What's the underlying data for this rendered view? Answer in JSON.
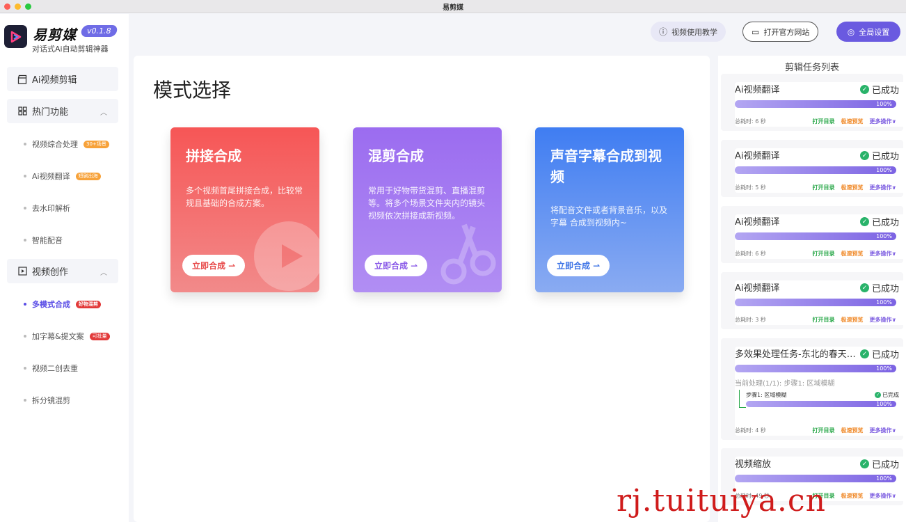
{
  "window": {
    "title": "易剪媒"
  },
  "brand": {
    "name": "易剪媒",
    "version": "v0.1.8",
    "slogan": "对话式Ai自动剪辑神器"
  },
  "nav": {
    "item1": "Ai视频剪辑",
    "group1": {
      "label": "热门功能",
      "items": [
        {
          "label": "视频综合处理",
          "tag": "30+场景"
        },
        {
          "label": "Ai视频翻译",
          "tag": "短剧出海"
        },
        {
          "label": "去水印解析"
        },
        {
          "label": "智能配音"
        }
      ]
    },
    "group2": {
      "label": "视频创作",
      "items": [
        {
          "label": "多模式合成",
          "tag": "好物混剪"
        },
        {
          "label": "加字幕&提文案",
          "tag": "可批量"
        },
        {
          "label": "视频二创去重"
        },
        {
          "label": "拆分镜混剪"
        }
      ]
    }
  },
  "toolbar": {
    "tutorial": "视频使用教学",
    "website": "打开官方网站",
    "settings": "全局设置"
  },
  "main": {
    "title": "模式选择",
    "cards": [
      {
        "title": "拼接合成",
        "desc": "多个视频首尾拼接合成，比较常规且基础的合成方案。",
        "button": "立即合成 ⇀"
      },
      {
        "title": "混剪合成",
        "desc": "常用于好物带货混剪、直播混剪等。将多个场景文件夹内的镜头视频依次拼接成新视频。",
        "button": "立即合成 ⇀"
      },
      {
        "title": "声音字幕合成到视频",
        "desc": "将配音文件或者背景音乐，以及字幕 合成到视频内~",
        "button": "立即合成 ⇀"
      }
    ]
  },
  "tasks": {
    "title": "剪辑任务列表",
    "status": "已成功",
    "progress_label": "100%",
    "actions": {
      "open": "打开目录",
      "preview": "极速预览",
      "more": "更多操作∨"
    },
    "items": [
      {
        "name": "Ai视频翻译",
        "time": "总耗时: 6 秒",
        "progress": 1.0
      },
      {
        "name": "Ai视频翻译",
        "time": "总耗时: 5 秒",
        "progress": 1.0
      },
      {
        "name": "Ai视频翻译",
        "time": "总耗时: 6 秒",
        "progress": 1.0
      },
      {
        "name": "Ai视频翻译",
        "time": "总耗时: 3 秒",
        "progress": 1.0
      },
      {
        "name": "多效果处理任务-东北的春天…",
        "time": "总耗时: 4 秒",
        "progress": 1.0,
        "current": "当前处理(1/1): 步骤1: 区域模糊",
        "step": "步骤1: 区域模糊",
        "step_status": "已完成"
      },
      {
        "name": "视频缩放",
        "time": "总耗时: 49 秒",
        "progress": 1.0
      }
    ]
  },
  "watermark": "rj.tuituiya.cn",
  "colors": {
    "accent": "#6a5ae0",
    "success": "#29b36a",
    "card1": "#f65656",
    "card2": "#9b6cf0",
    "card3": "#3f7df2"
  }
}
